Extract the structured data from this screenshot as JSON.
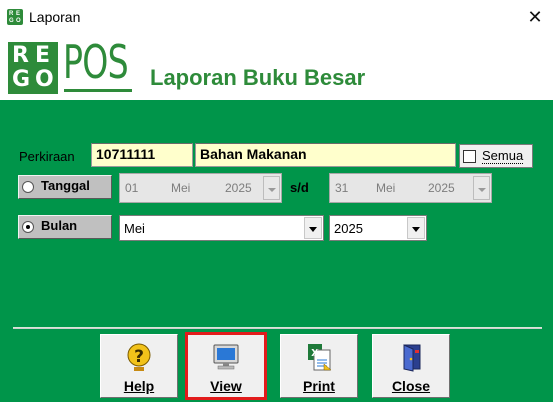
{
  "window": {
    "title": "Laporan",
    "close_glyph": "✕"
  },
  "header": {
    "logo_letters": [
      "R",
      "E",
      "G",
      "O"
    ],
    "logo_text": "POS",
    "report_title": "Laporan Buku Besar",
    "brand_color": "#2e8b3a"
  },
  "form": {
    "perkiraan_label": "Perkiraan",
    "account_code": "10711111",
    "account_name": "Bahan Makanan",
    "semua_label": "Semua",
    "semua_checked": false,
    "tanggal_label": "Tanggal",
    "tanggal_selected": false,
    "date_from": {
      "day": "01",
      "month": "Mei",
      "year": "2025"
    },
    "sd_label": "s/d",
    "date_to": {
      "day": "31",
      "month": "Mei",
      "year": "2025"
    },
    "bulan_label": "Bulan",
    "bulan_selected": true,
    "month_value": "Mei",
    "year_value": "2025",
    "panel_color": "#00954a"
  },
  "buttons": [
    {
      "label": "Help",
      "icon": "question-icon",
      "active": false
    },
    {
      "label": "View",
      "icon": "monitor-icon",
      "active": true
    },
    {
      "label": "Print",
      "icon": "print-icon",
      "active": false
    },
    {
      "label": "Close",
      "icon": "exit-door-icon",
      "active": false
    }
  ]
}
